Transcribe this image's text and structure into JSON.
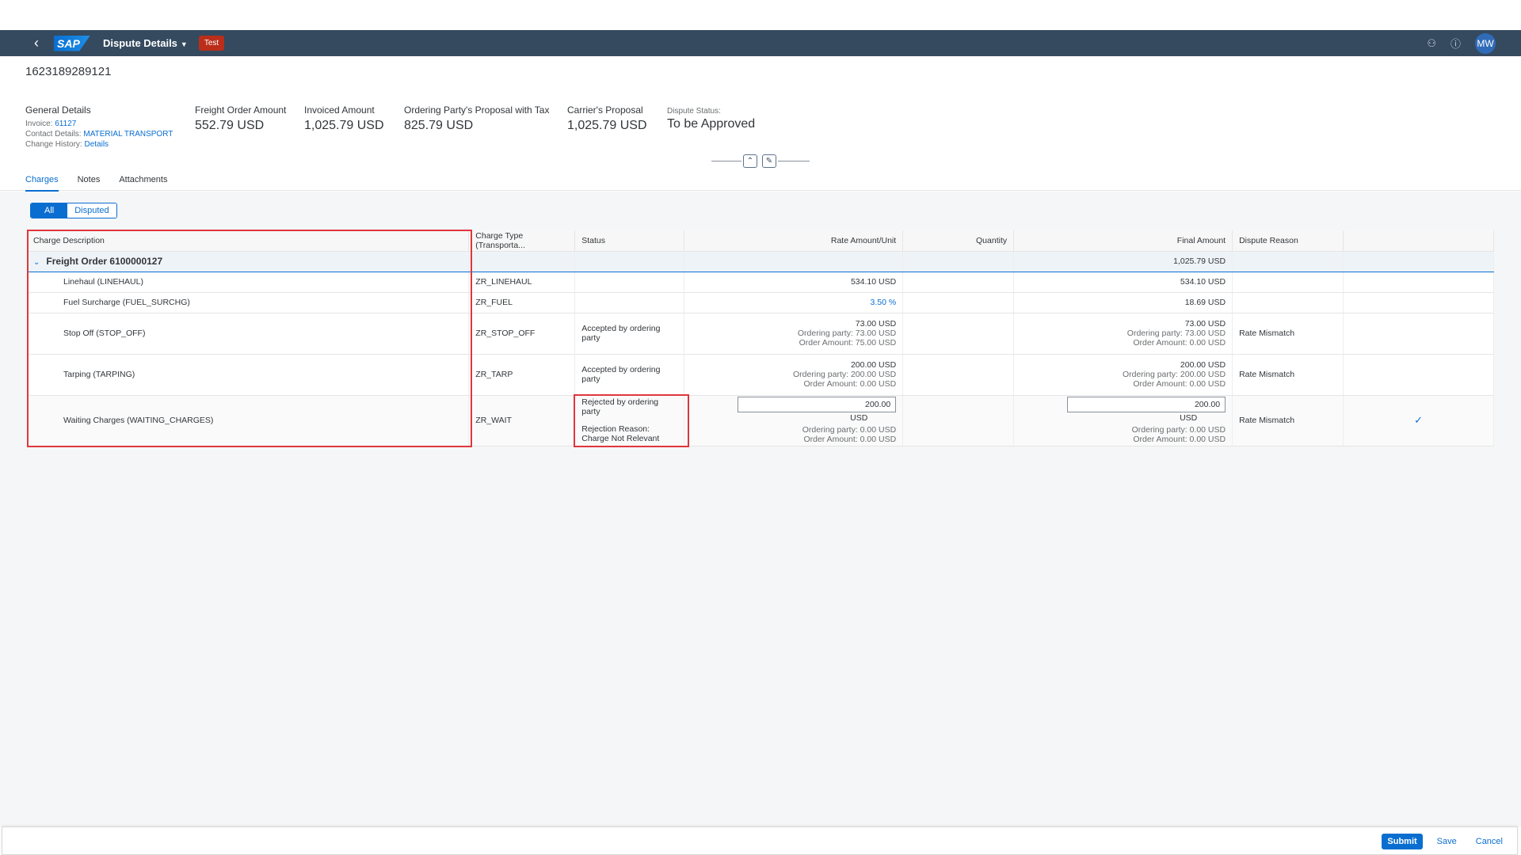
{
  "shell": {
    "back_icon": "chevron-left-icon",
    "logo": "SAP",
    "app_title": "Dispute Details",
    "env_badge": "Test",
    "avatar": "MW",
    "icons": [
      "connection-icon",
      "help-icon"
    ]
  },
  "header": {
    "object_id": "1623189289121",
    "general": {
      "label": "General Details",
      "invoice_label": "Invoice:",
      "invoice_value": "61127",
      "contact_label": "Contact Details:",
      "contact_value": "MATERIAL TRANSPORT",
      "history_label": "Change History:",
      "history_value": "Details"
    },
    "freight_order_amount": {
      "label": "Freight Order Amount",
      "value": "552.79 USD"
    },
    "invoiced_amount": {
      "label": "Invoiced Amount",
      "value": "1,025.79 USD"
    },
    "ordering_proposal": {
      "label": "Ordering Party's Proposal with Tax",
      "value": "825.79 USD"
    },
    "carrier_proposal": {
      "label": "Carrier's Proposal",
      "value": "1,025.79 USD"
    },
    "dispute_status": {
      "label": "Dispute Status:",
      "value": "To be Approved"
    }
  },
  "tabs": [
    {
      "label": "Charges",
      "active": true
    },
    {
      "label": "Notes",
      "active": false
    },
    {
      "label": "Attachments",
      "active": false
    }
  ],
  "filter": {
    "all": "All",
    "disputed": "Disputed"
  },
  "table": {
    "columns": [
      "Charge Description",
      "Charge Type (Transporta...",
      "Status",
      "Rate Amount/Unit",
      "Quantity",
      "Final Amount",
      "Dispute Reason",
      ""
    ],
    "group": {
      "name": "Freight Order 6100000127",
      "final": "1,025.79 USD"
    },
    "rows": [
      {
        "desc": "Linehaul (LINEHAUL)",
        "type": "ZR_LINEHAUL",
        "status": "",
        "rate": "534.10 USD",
        "final": "534.10 USD",
        "reason": ""
      },
      {
        "desc": "Fuel Surcharge (FUEL_SURCHG)",
        "type": "ZR_FUEL",
        "status": "",
        "rate": "3.50 %",
        "final": "18.69 USD",
        "reason": ""
      },
      {
        "desc": "Stop Off (STOP_OFF)",
        "type": "ZR_STOP_OFF",
        "status": "Accepted by ordering party",
        "rate": "73.00 USD",
        "rate_op": "Ordering party: 73.00 USD",
        "rate_oa": "Order Amount: 75.00 USD",
        "final": "73.00 USD",
        "final_op": "Ordering party: 73.00 USD",
        "final_oa": "Order Amount: 0.00 USD",
        "reason": "Rate Mismatch"
      },
      {
        "desc": "Tarping (TARPING)",
        "type": "ZR_TARP",
        "status": "Accepted by ordering party",
        "rate": "200.00 USD",
        "rate_op": "Ordering party: 200.00 USD",
        "rate_oa": "Order Amount: 0.00 USD",
        "final": "200.00 USD",
        "final_op": "Ordering party: 200.00 USD",
        "final_oa": "Order Amount: 0.00 USD",
        "reason": "Rate Mismatch"
      },
      {
        "desc": "Waiting Charges (WAITING_CHARGES)",
        "type": "ZR_WAIT",
        "status": "Rejected by ordering party",
        "rej_label": "Rejection Reason:",
        "rej_value": "Charge Not Relevant",
        "rate_input": "200.00",
        "rate_unit": "USD",
        "rate_op": "Ordering party: 0.00 USD",
        "rate_oa": "Order Amount: 0.00 USD",
        "final_input": "200.00",
        "final_unit": "USD",
        "final_op": "Ordering party: 0.00 USD",
        "final_oa": "Order Amount: 0.00 USD",
        "reason": "Rate Mismatch",
        "check": "✓"
      }
    ]
  },
  "footer": {
    "submit": "Submit",
    "save": "Save",
    "cancel": "Cancel"
  }
}
